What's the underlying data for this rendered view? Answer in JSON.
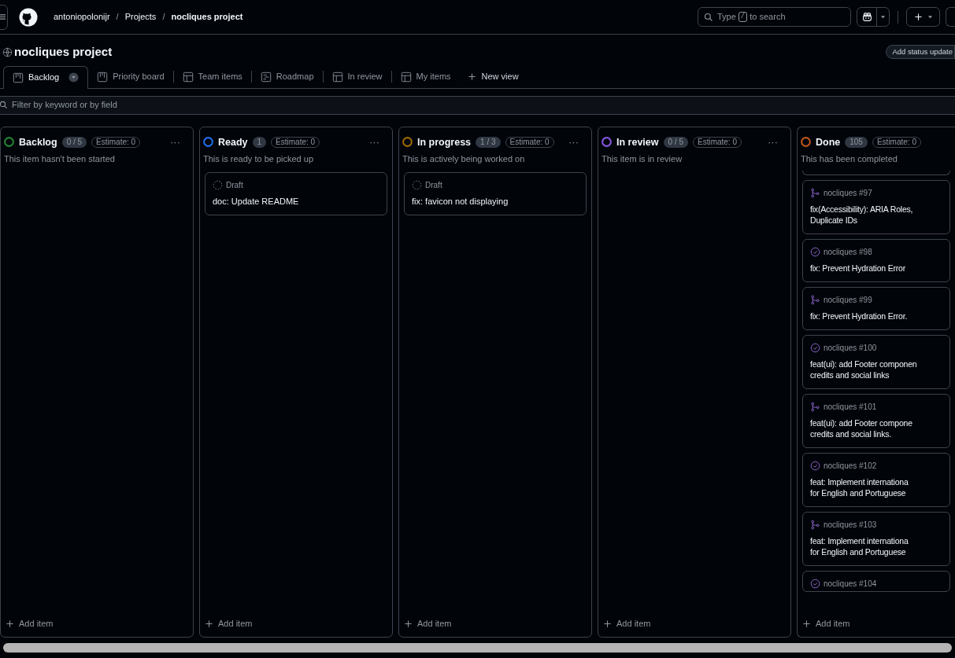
{
  "header": {
    "breadcrumbs": [
      {
        "kind": "link",
        "text": "antoniopolonijr"
      },
      {
        "kind": "separator",
        "text": "/"
      },
      {
        "kind": "link",
        "text": "Projects"
      },
      {
        "kind": "separator",
        "text": "/"
      },
      {
        "kind": "current",
        "text": "nocliques project"
      }
    ],
    "search": {
      "placeholder_parts": [
        "Type",
        "/",
        "to search"
      ]
    }
  },
  "project": {
    "title": "nocliques project",
    "status_button": "Add status update"
  },
  "tabs": [
    {
      "label": "Backlog",
      "kind": "board",
      "selected": true
    },
    {
      "label": "Priority board",
      "kind": "board",
      "selected": false
    },
    {
      "label": "Team items",
      "kind": "table",
      "selected": false
    },
    {
      "label": "Roadmap",
      "kind": "roadmap",
      "selected": false
    },
    {
      "label": "In review",
      "kind": "table",
      "selected": false
    },
    {
      "label": "My items",
      "kind": "table",
      "selected": false
    }
  ],
  "new_view": "New view",
  "filter": {
    "placeholder": "Filter by keyword or by field"
  },
  "columns": [
    {
      "name": "Backlog",
      "color": "#238636",
      "count": "0 / 5",
      "estimate": "Estimate: 0",
      "description": "This item hasn't been started",
      "menu": "···",
      "add_item": "Add item"
    },
    {
      "name": "Ready",
      "color": "#1f6feb",
      "count": "1",
      "estimate": "Estimate: 0",
      "description": "This is ready to be picked up",
      "menu": "···",
      "add_item": "Add item",
      "cards": [
        {
          "kind": "draft",
          "meta": "Draft",
          "title": "doc: Update README"
        }
      ]
    },
    {
      "name": "In progress",
      "color": "#9e6a03",
      "count": "1 / 3",
      "estimate": "Estimate: 0",
      "description": "This is actively being worked on",
      "menu": "···",
      "add_item": "Add item",
      "cards": [
        {
          "kind": "draft",
          "meta": "Draft",
          "title": "fix: favicon not displaying"
        }
      ]
    },
    {
      "name": "In review",
      "color": "#8957e5",
      "count": "0 / 5",
      "estimate": "Estimate: 0",
      "description": "This item is in review",
      "menu": "···",
      "add_item": "Add item"
    },
    {
      "name": "Done",
      "color": "#bd561d",
      "count": "105",
      "estimate": "Estimate: 0",
      "description": "This has been completed",
      "add_item": "Add item",
      "cards": [
        {
          "kind": "clipped"
        },
        {
          "kind": "pull-request",
          "meta": "nocliques #97",
          "title": "fix(Accessibility): ARIA Roles,\nDuplicate IDs"
        },
        {
          "kind": "issue",
          "meta": "nocliques #98",
          "title": "fix: Prevent Hydration Error"
        },
        {
          "kind": "pull-request",
          "meta": "nocliques #99",
          "title": "fix: Prevent Hydration Error."
        },
        {
          "kind": "issue",
          "meta": "nocliques #100",
          "title": "feat(ui): add Footer componen\ncredits and social links"
        },
        {
          "kind": "pull-request",
          "meta": "nocliques #101",
          "title": "feat(ui): add Footer compone\ncredits and social links."
        },
        {
          "kind": "issue",
          "meta": "nocliques #102",
          "title": "feat: Implement internationa\nfor English and Portuguese"
        },
        {
          "kind": "pull-request",
          "meta": "nocliques #103",
          "title": "feat: Implement internationa\nfor English and Portuguese"
        },
        {
          "kind": "issue",
          "meta": "nocliques #104"
        }
      ]
    }
  ]
}
